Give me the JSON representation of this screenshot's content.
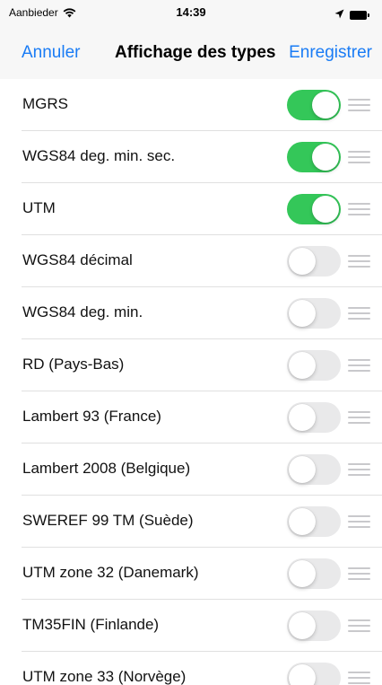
{
  "status_bar": {
    "carrier": "Aanbieder",
    "time": "14:39",
    "icons": [
      "wifi-icon",
      "location-arrow-icon",
      "battery-icon"
    ]
  },
  "nav": {
    "cancel_label": "Annuler",
    "title": "Affichage des types",
    "save_label": "Enregistrer"
  },
  "colors": {
    "accent": "#1a7cf5",
    "toggle_on": "#34c759",
    "toggle_off": "#e9e9ea"
  },
  "rows": [
    {
      "label": "MGRS",
      "enabled": true
    },
    {
      "label": "WGS84 deg. min. sec.",
      "enabled": true
    },
    {
      "label": "UTM",
      "enabled": true
    },
    {
      "label": "WGS84 décimal",
      "enabled": false
    },
    {
      "label": "WGS84 deg. min.",
      "enabled": false
    },
    {
      "label": "RD (Pays-Bas)",
      "enabled": false
    },
    {
      "label": "Lambert 93 (France)",
      "enabled": false
    },
    {
      "label": "Lambert 2008 (Belgique)",
      "enabled": false
    },
    {
      "label": "SWEREF 99 TM (Suède)",
      "enabled": false
    },
    {
      "label": "UTM zone 32 (Danemark)",
      "enabled": false
    },
    {
      "label": "TM35FIN (Finlande)",
      "enabled": false
    },
    {
      "label": "UTM zone 33 (Norvège)",
      "enabled": false
    }
  ]
}
